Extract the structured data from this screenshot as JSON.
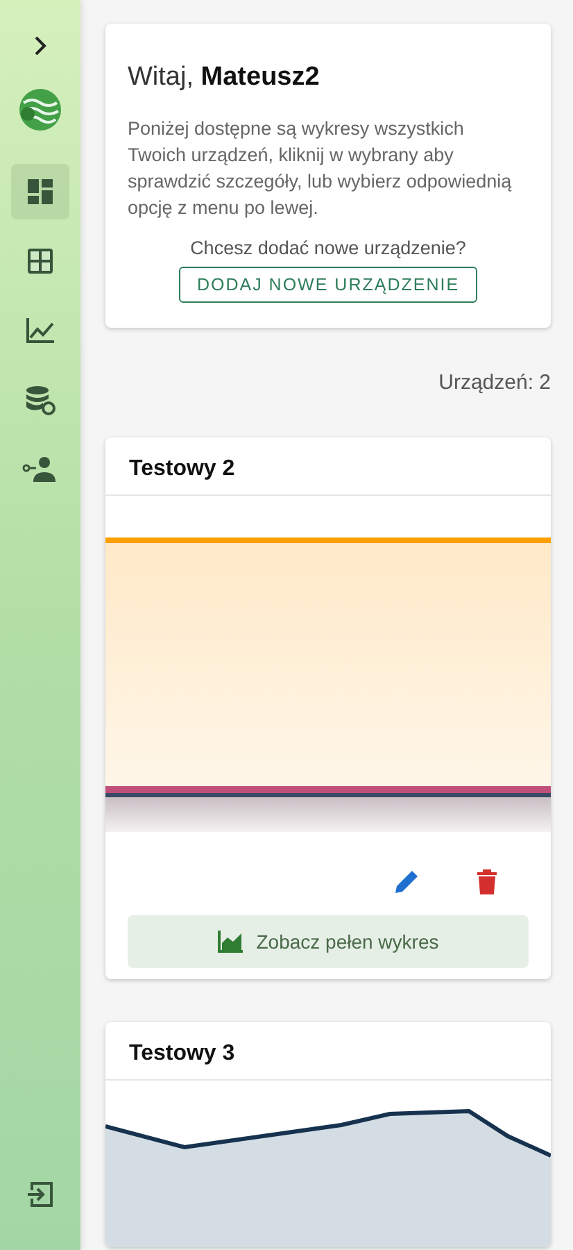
{
  "sidebar": {
    "nav_items": [
      {
        "kind": "dashboard",
        "selected": true
      },
      {
        "kind": "table",
        "selected": false
      },
      {
        "kind": "chart",
        "selected": false
      },
      {
        "kind": "database",
        "selected": false
      },
      {
        "kind": "user-key",
        "selected": false
      }
    ]
  },
  "welcome": {
    "greeting": "Witaj,",
    "user": "Mateusz2",
    "text": "Poniżej dostępne są wykresy wszystkich Twoich urządzeń, kliknij w wybrany aby sprawdzić szczegóły, lub wybierz odpowiednią opcję z menu po lewej.",
    "question": "Chcesz dodać nowe urządzenie?",
    "add_button": "DODAJ NOWE URZĄDZENIE"
  },
  "device_count": "Urządzeń: 2",
  "devices": [
    {
      "name": "Testowy 2",
      "kind": "band",
      "full_chart_button": "Zobacz pełen wykres"
    },
    {
      "name": "Testowy 3",
      "kind": "line"
    }
  ]
}
